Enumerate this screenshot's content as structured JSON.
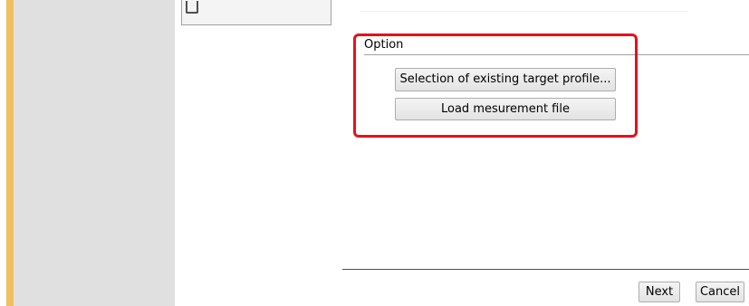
{
  "colors": {
    "left_accent": "#f0c060",
    "left_panel": "#e0e0e0",
    "highlight_border": "#e8101c",
    "button_bg": "#e8e8e8",
    "button_border": "#adadad"
  },
  "option_section": {
    "label": "Option",
    "select_profile_button": "Selection of existing target profile...",
    "load_measurement_button": "Load mesurement file"
  },
  "footer": {
    "next_button": "Next",
    "cancel_button": "Cancel"
  }
}
